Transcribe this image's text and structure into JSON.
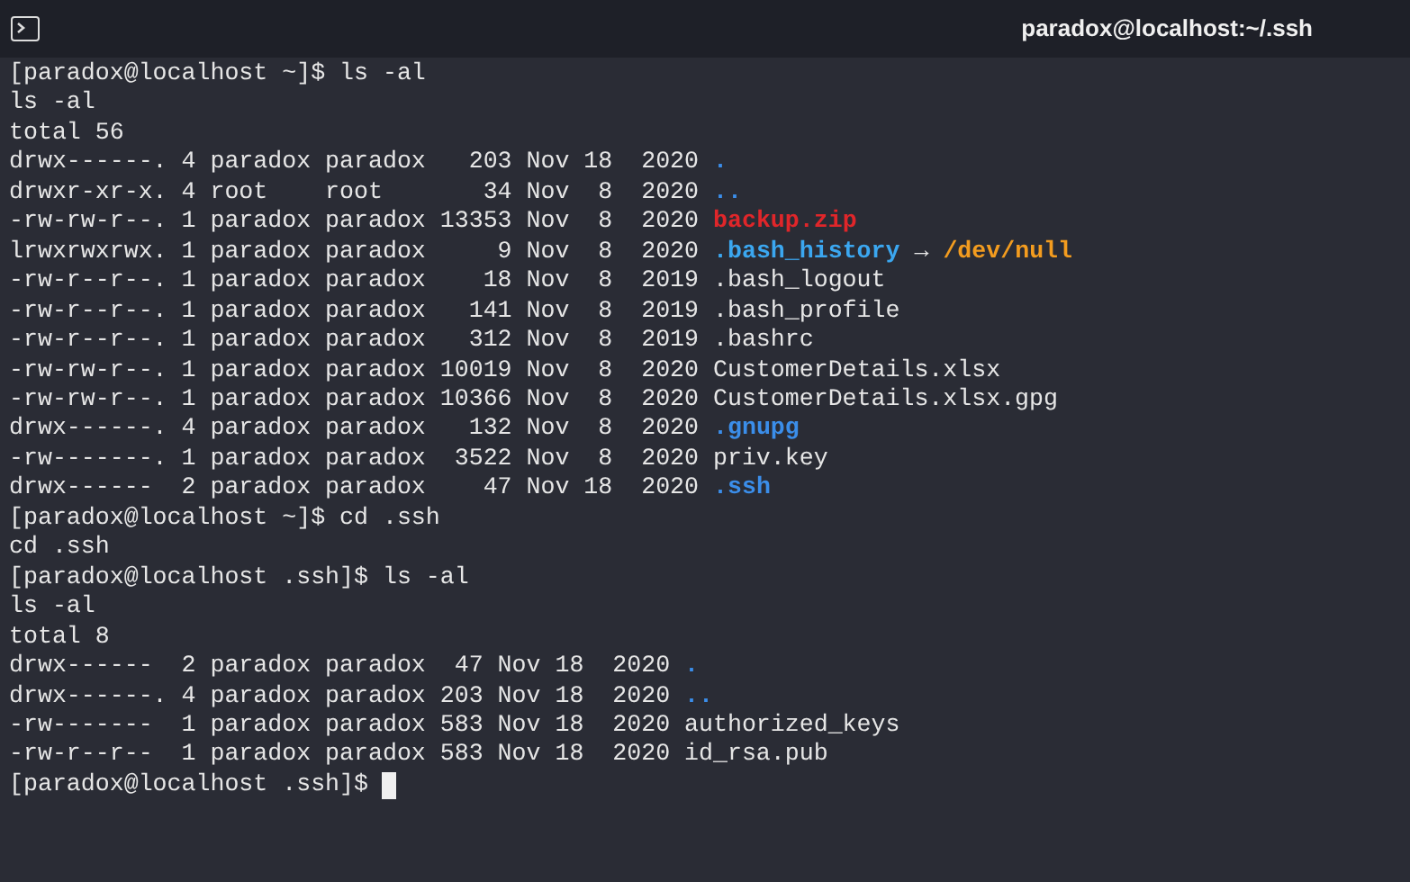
{
  "window": {
    "title": "paradox@localhost:~/.ssh"
  },
  "lines": [
    [
      {
        "kind": "plain",
        "text": "[paradox@localhost ~]$ ls -al"
      }
    ],
    [
      {
        "kind": "plain",
        "text": "ls -al"
      }
    ],
    [
      {
        "kind": "plain",
        "text": "total 56"
      }
    ],
    [
      {
        "kind": "plain",
        "text": "drwx------. 4 paradox paradox   203 Nov 18  2020 "
      },
      {
        "kind": "dir",
        "text": "."
      }
    ],
    [
      {
        "kind": "plain",
        "text": "drwxr-xr-x. 4 root    root       34 Nov  8  2020 "
      },
      {
        "kind": "dir",
        "text": ".."
      }
    ],
    [
      {
        "kind": "plain",
        "text": "-rw-rw-r--. 1 paradox paradox 13353 Nov  8  2020 "
      },
      {
        "kind": "archive",
        "text": "backup.zip"
      }
    ],
    [
      {
        "kind": "plain",
        "text": "lrwxrwxrwx. 1 paradox paradox     9 Nov  8  2020 "
      },
      {
        "kind": "link",
        "text": ".bash_history"
      },
      {
        "kind": "plain",
        "text": " → "
      },
      {
        "kind": "target",
        "text": "/dev/null"
      }
    ],
    [
      {
        "kind": "plain",
        "text": "-rw-r--r--. 1 paradox paradox    18 Nov  8  2019 .bash_logout"
      }
    ],
    [
      {
        "kind": "plain",
        "text": "-rw-r--r--. 1 paradox paradox   141 Nov  8  2019 .bash_profile"
      }
    ],
    [
      {
        "kind": "plain",
        "text": "-rw-r--r--. 1 paradox paradox   312 Nov  8  2019 .bashrc"
      }
    ],
    [
      {
        "kind": "plain",
        "text": "-rw-rw-r--. 1 paradox paradox 10019 Nov  8  2020 CustomerDetails.xlsx"
      }
    ],
    [
      {
        "kind": "plain",
        "text": "-rw-rw-r--. 1 paradox paradox 10366 Nov  8  2020 CustomerDetails.xlsx.gpg"
      }
    ],
    [
      {
        "kind": "plain",
        "text": "drwx------. 4 paradox paradox   132 Nov  8  2020 "
      },
      {
        "kind": "dir",
        "text": ".gnupg"
      }
    ],
    [
      {
        "kind": "plain",
        "text": "-rw-------. 1 paradox paradox  3522 Nov  8  2020 priv.key"
      }
    ],
    [
      {
        "kind": "plain",
        "text": "drwx------  2 paradox paradox    47 Nov 18  2020 "
      },
      {
        "kind": "dir",
        "text": ".ssh"
      }
    ],
    [
      {
        "kind": "plain",
        "text": "[paradox@localhost ~]$ cd .ssh"
      }
    ],
    [
      {
        "kind": "plain",
        "text": "cd .ssh"
      }
    ],
    [
      {
        "kind": "plain",
        "text": "[paradox@localhost .ssh]$ ls -al"
      }
    ],
    [
      {
        "kind": "plain",
        "text": "ls -al"
      }
    ],
    [
      {
        "kind": "plain",
        "text": "total 8"
      }
    ],
    [
      {
        "kind": "plain",
        "text": "drwx------  2 paradox paradox  47 Nov 18  2020 "
      },
      {
        "kind": "dir",
        "text": "."
      }
    ],
    [
      {
        "kind": "plain",
        "text": "drwx------. 4 paradox paradox 203 Nov 18  2020 "
      },
      {
        "kind": "dir",
        "text": ".."
      }
    ],
    [
      {
        "kind": "plain",
        "text": "-rw-------  1 paradox paradox 583 Nov 18  2020 authorized_keys"
      }
    ],
    [
      {
        "kind": "plain",
        "text": "-rw-r--r--  1 paradox paradox 583 Nov 18  2020 id_rsa.pub"
      }
    ]
  ],
  "prompt": "[paradox@localhost .ssh]$ "
}
